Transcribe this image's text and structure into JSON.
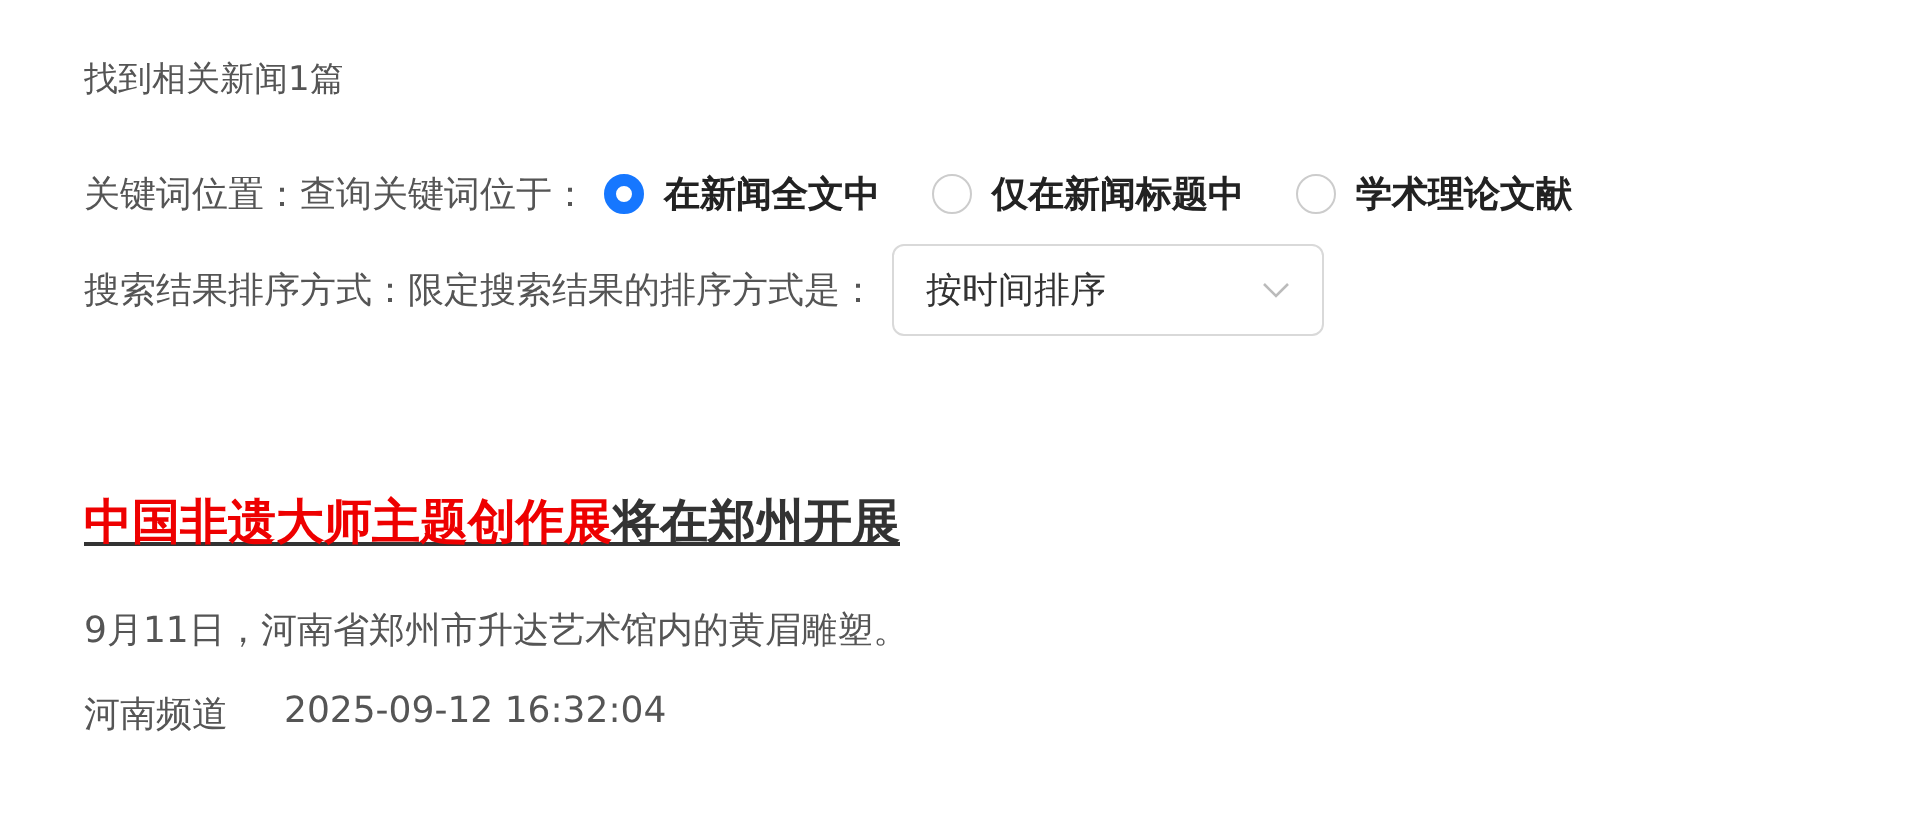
{
  "result_count": "找到相关新闻1篇",
  "filters": [
    {
      "kind": "radio",
      "label": "关键词位置：",
      "hint": "查询关键词位于：",
      "options": [
        {
          "label": "在新闻全文中",
          "selected": true
        },
        {
          "label": "仅在新闻标题中",
          "selected": false
        },
        {
          "label": "学术理论文献",
          "selected": false
        }
      ]
    },
    {
      "kind": "select",
      "label": "搜索结果排序方式：",
      "hint": "限定搜索结果的排序方式是：",
      "value": "按时间排序"
    }
  ],
  "results": [
    {
      "title_parts": [
        {
          "text": "中国非遗大师主题创作展",
          "highlighted": true
        },
        {
          "text": "将在郑州开展",
          "highlighted": false
        }
      ],
      "summary": "9月11日，河南省郑州市升达艺术馆内的黄眉雕塑。",
      "source": "河南频道",
      "time": "2025-09-12 16:32:04"
    }
  ]
}
